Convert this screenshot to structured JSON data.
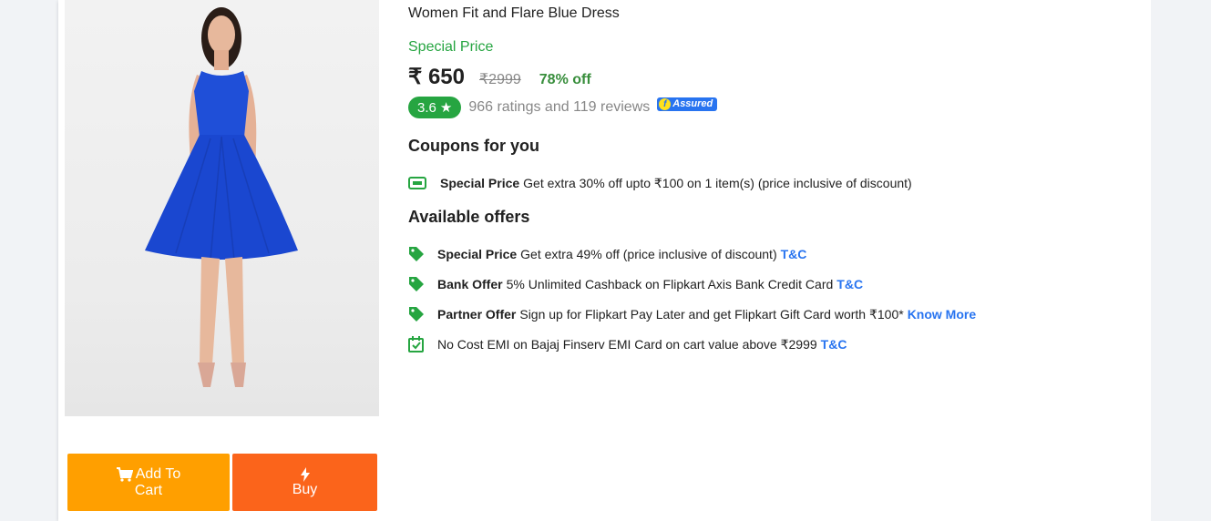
{
  "buttons": {
    "add_to_cart_line1": "Add To",
    "add_to_cart_line2": "Cart",
    "buy": "Buy"
  },
  "product": {
    "title": "Women Fit and Flare Blue Dress",
    "special_price_label": "Special Price",
    "price": "₹ 650",
    "mrp": "₹2999",
    "discount": "78% off",
    "rating": "3.6",
    "rating_star": "★",
    "ratings_text": "966 ratings and 119 reviews",
    "assured_label": "Assured"
  },
  "coupons": {
    "heading": "Coupons for you",
    "items": [
      {
        "title": "Special Price",
        "text": "Get extra 30% off upto ₹100 on 1 item(s) (price inclusive of discount)"
      }
    ]
  },
  "offers": {
    "heading": "Available offers",
    "items": [
      {
        "title": "Special Price",
        "text": "Get extra 49% off (price inclusive of discount)",
        "link": "T&C"
      },
      {
        "title": "Bank Offer",
        "text": "5% Unlimited Cashback on Flipkart Axis Bank Credit Card",
        "link": "T&C"
      },
      {
        "title": "Partner Offer",
        "text": "Sign up for Flipkart Pay Later and get Flipkart Gift Card worth ₹100*",
        "link": "Know More"
      },
      {
        "title": "",
        "text": "No Cost EMI on Bajaj Finserv EMI Card on cart value above ₹2999",
        "link": "T&C"
      }
    ]
  },
  "colors": {
    "green": "#26a541",
    "blue_link": "#2874f0",
    "cart_orange": "#ff9f00",
    "buy_orange": "#fb641b"
  }
}
